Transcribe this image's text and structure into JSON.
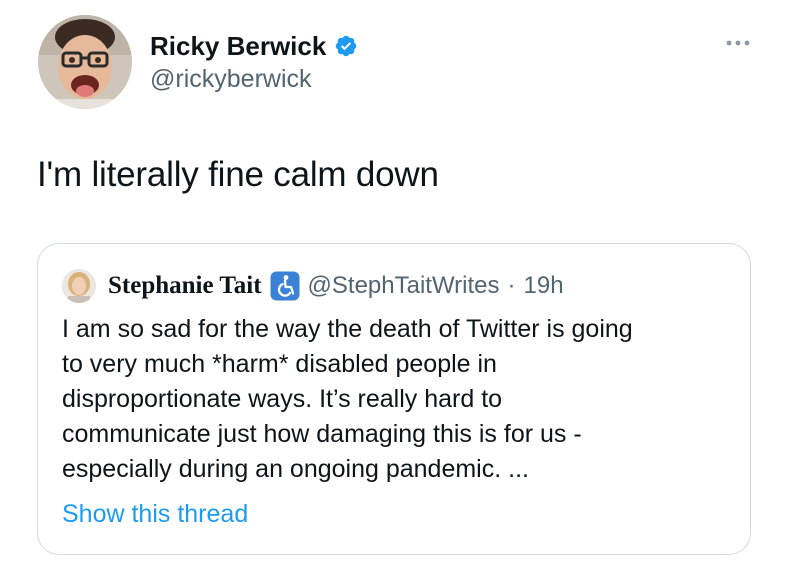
{
  "tweet": {
    "author": {
      "display_name": "Ricky Berwick",
      "handle": "@rickyberwick",
      "verified": true
    },
    "text": "I'm literally fine calm down",
    "icons": {
      "verified": "verified-badge-icon",
      "more": "more-options-icon"
    },
    "colors": {
      "verified": "#1d9bf0",
      "link": "#1d9bf0",
      "secondary_text": "#536471",
      "border": "#d6dade"
    }
  },
  "quote": {
    "author": {
      "display_name": "Stephanie Tait",
      "handle": "@StephTaitWrites",
      "separator": "·",
      "time": "19h",
      "badge_icon": "accessibility-icon"
    },
    "text_lines": [
      "I am so sad for the way the death of Twitter is going",
      "to very much *harm* disabled people in",
      "disproportionate ways. It’s really hard to",
      "communicate just how damaging this is for us -",
      "especially during an ongoing pandemic. ..."
    ],
    "show_thread_label": "Show this thread"
  }
}
